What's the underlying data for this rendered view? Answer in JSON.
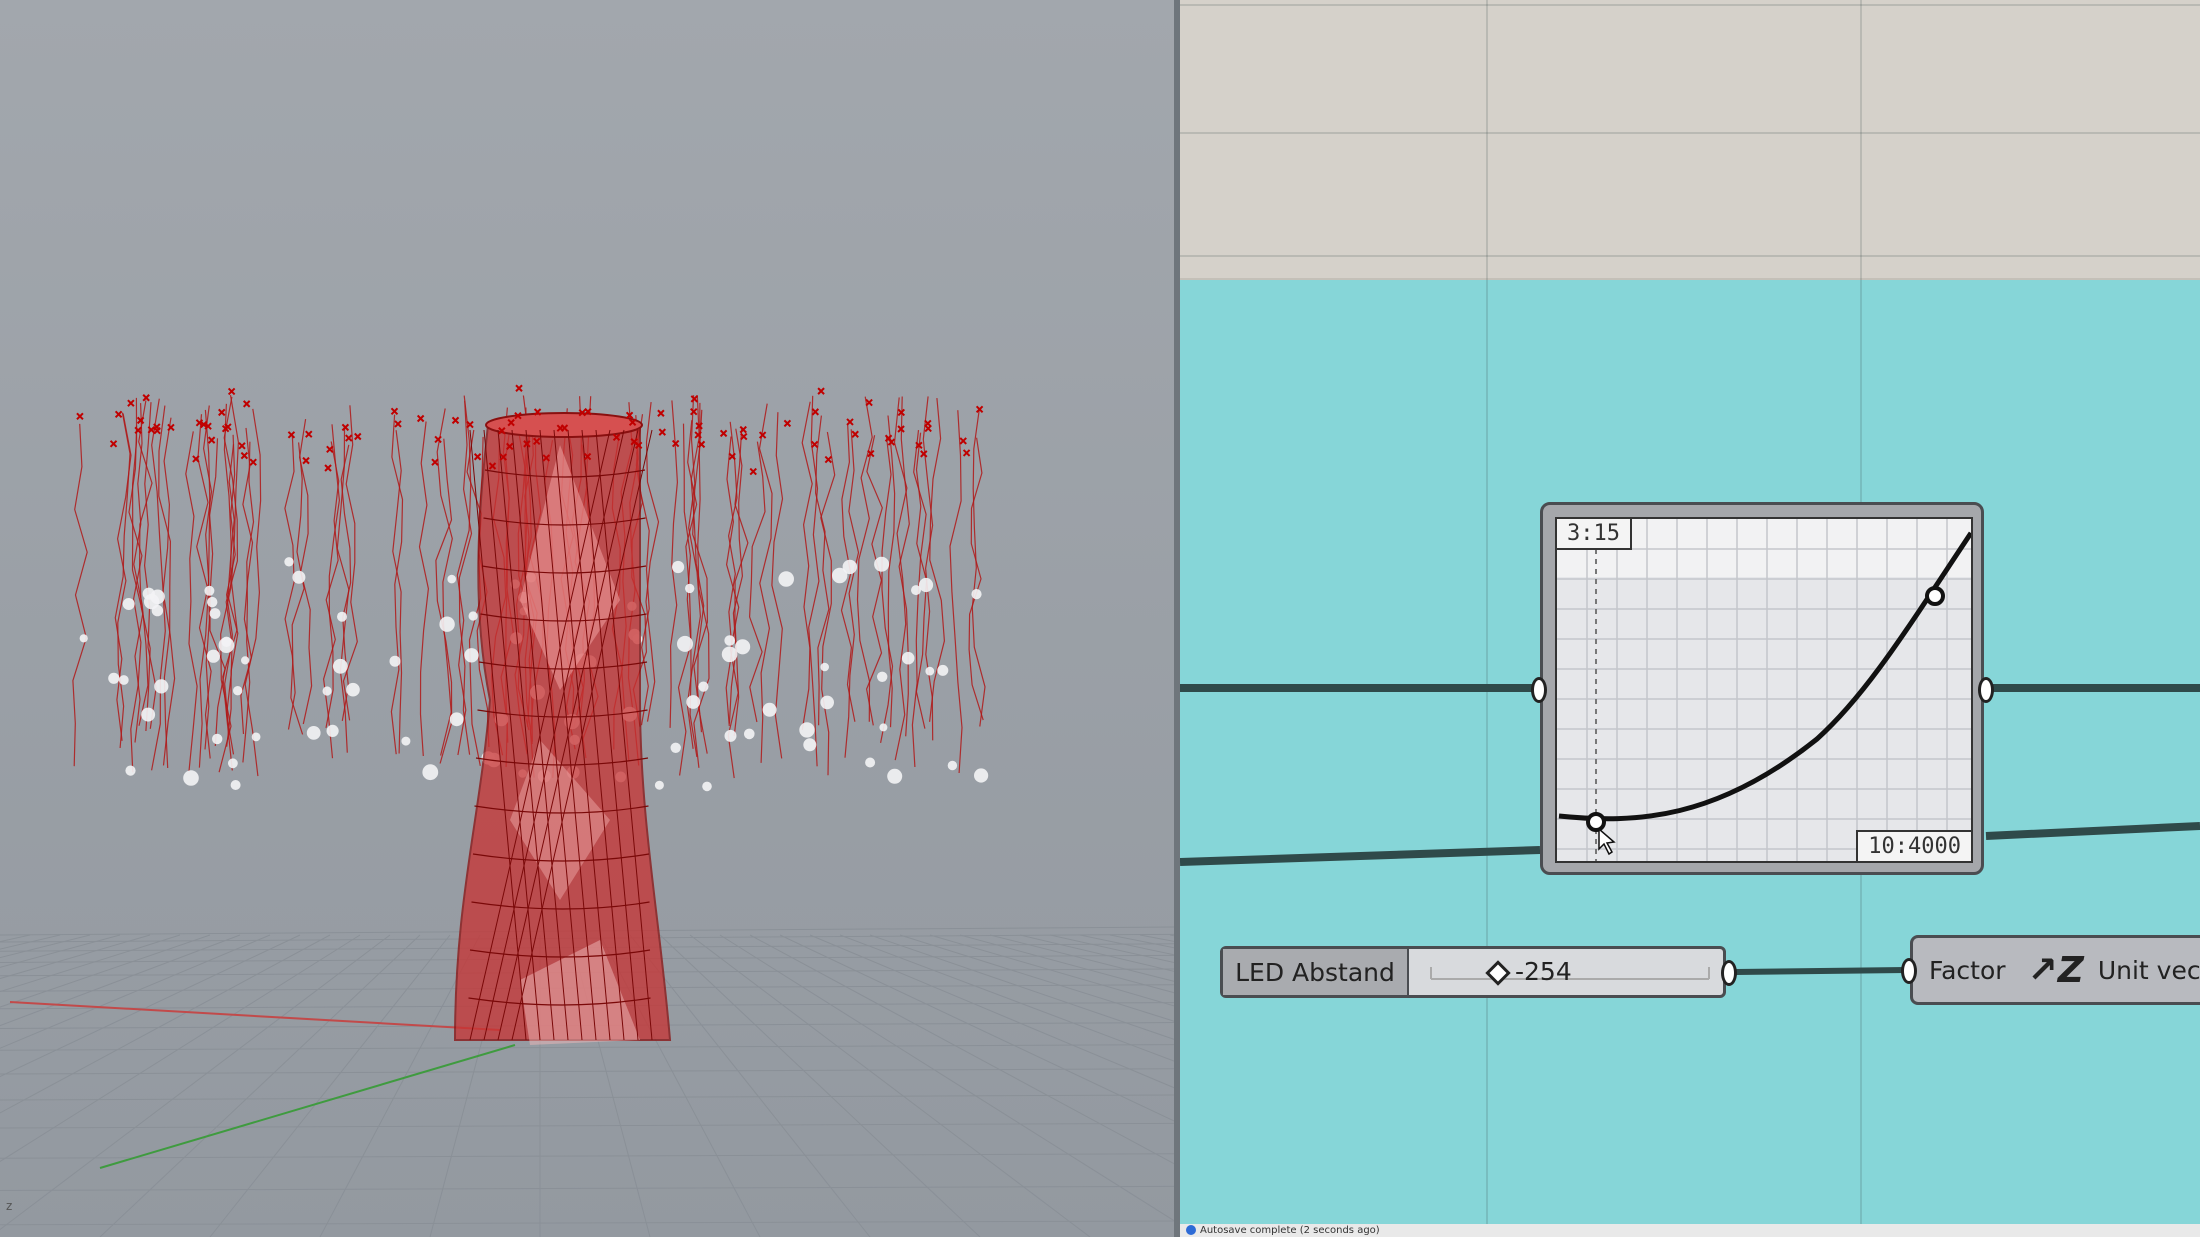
{
  "viewport": {
    "axis_hint": "z"
  },
  "canvas": {
    "graph_mapper": {
      "top_label": "3:15",
      "bottom_label": "10:4000"
    },
    "slider": {
      "name": "LED Abstand",
      "value": "-254"
    },
    "unit_vector": {
      "input_label": "Factor",
      "icon": "unit-vector-icon",
      "name": "Unit vecto"
    }
  },
  "status_bar": {
    "text": "Autosave complete (2 seconds ago)"
  }
}
